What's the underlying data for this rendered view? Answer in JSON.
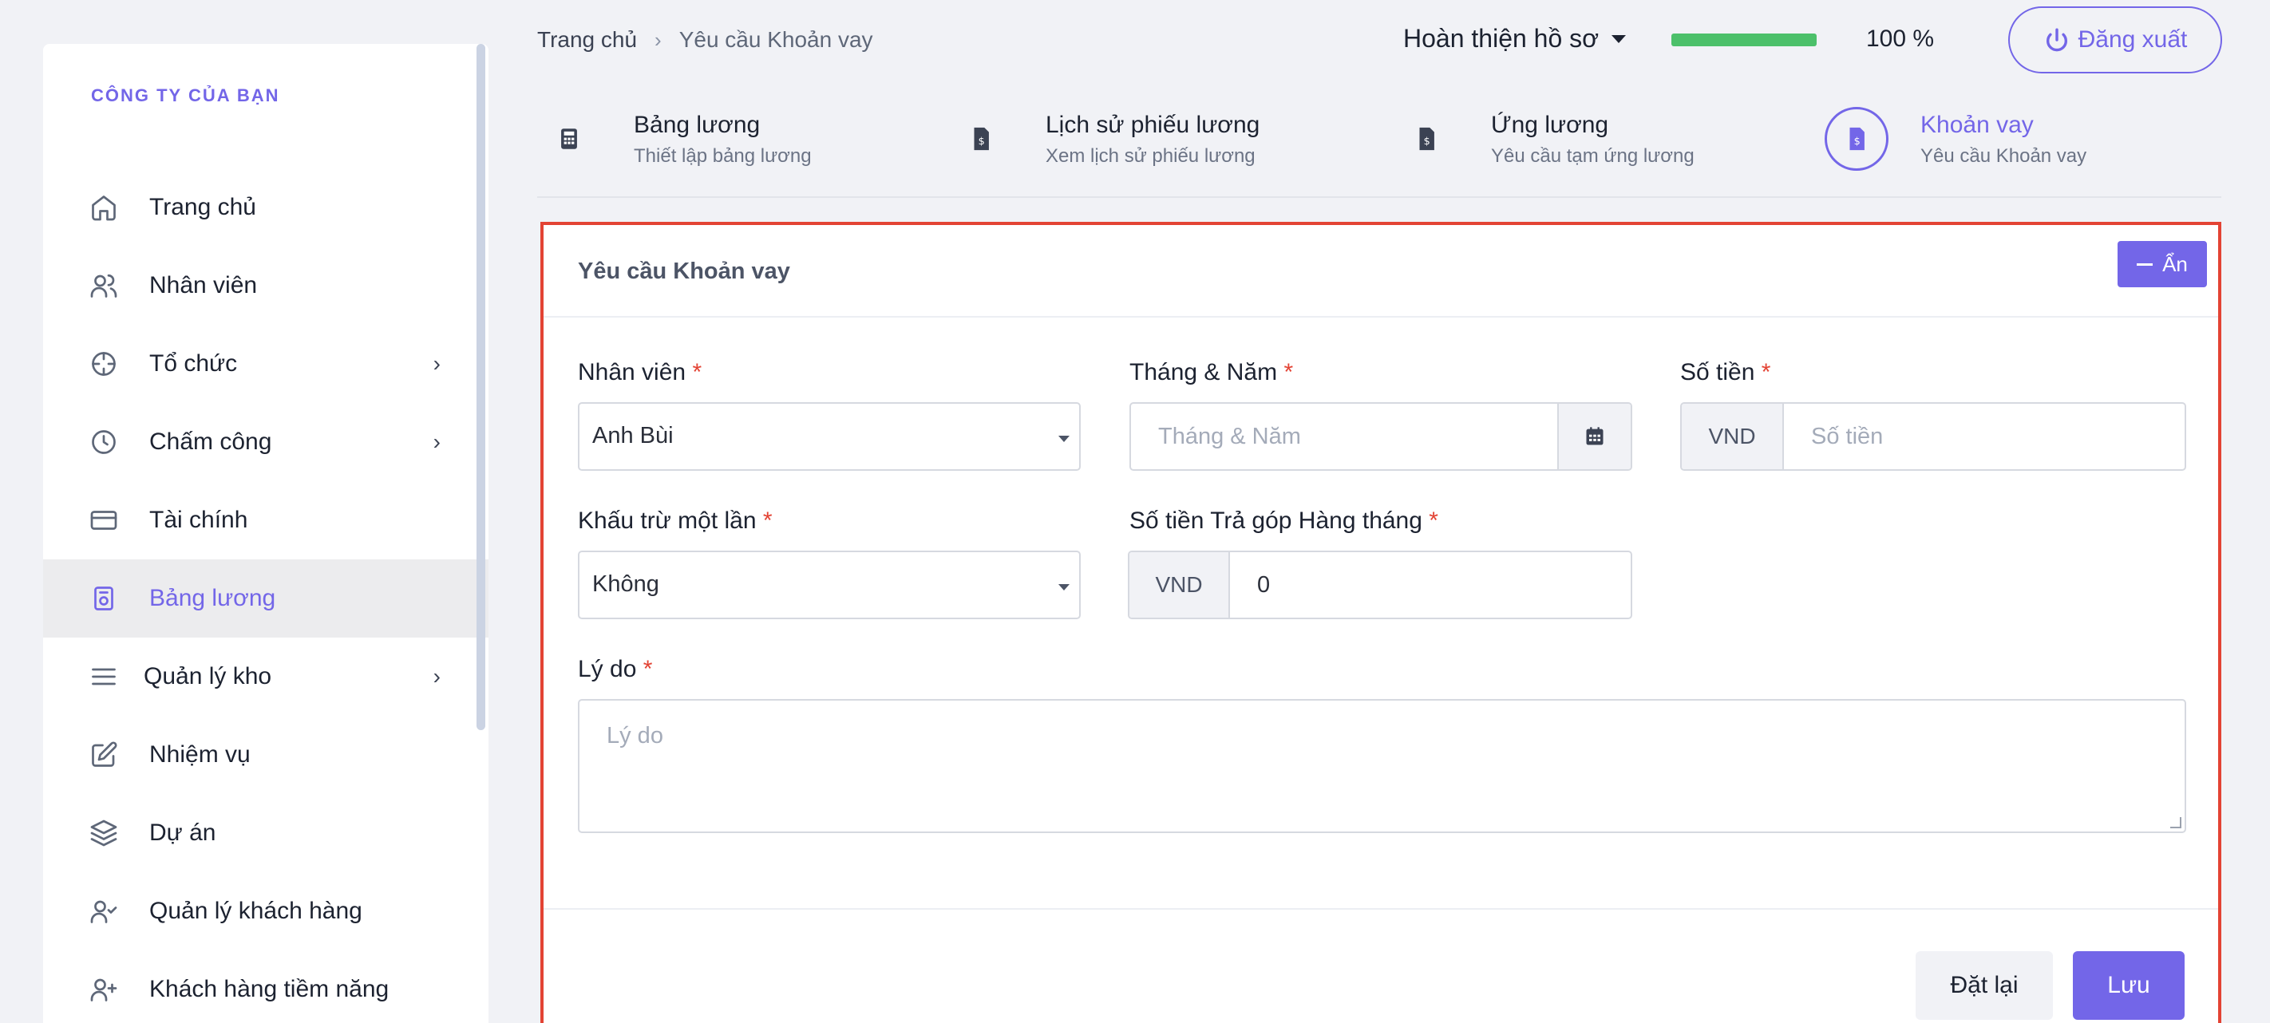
{
  "colors": {
    "accent": "#7366e8",
    "danger": "#e34334",
    "progress": "#4cc06a"
  },
  "sidebar": {
    "brand": "CÔNG TY CỦA BẠN",
    "items": [
      {
        "label": "Trang chủ",
        "icon": "home-icon",
        "chevron": ""
      },
      {
        "label": "Nhân viên",
        "icon": "users-icon",
        "chevron": ""
      },
      {
        "label": "Tổ chức",
        "icon": "crosshair-icon",
        "chevron": "›"
      },
      {
        "label": "Chấm công",
        "icon": "clock-icon",
        "chevron": "›"
      },
      {
        "label": "Tài chính",
        "icon": "credit-card-icon",
        "chevron": ""
      },
      {
        "label": "Bảng lương",
        "icon": "payroll-icon",
        "chevron": "",
        "active": true
      },
      {
        "label": "Quản lý kho",
        "icon": "menu-icon",
        "chevron": "›"
      },
      {
        "label": "Nhiệm vụ",
        "icon": "edit-icon",
        "chevron": ""
      },
      {
        "label": "Dự án",
        "icon": "layers-icon",
        "chevron": ""
      },
      {
        "label": "Quản lý khách hàng",
        "icon": "user-check-icon",
        "chevron": ""
      },
      {
        "label": "Khách hàng tiềm năng",
        "icon": "user-plus-icon",
        "chevron": ""
      }
    ]
  },
  "header": {
    "breadcrumb": {
      "home": "Trang chủ",
      "separator": "›",
      "current": "Yêu cầu Khoản vay"
    },
    "complete_profile": "Hoàn thiện hồ sơ",
    "progress_percent": 100,
    "progress_text": "100 %",
    "logout": "Đăng xuất"
  },
  "tabs": [
    {
      "title": "Bảng lương",
      "subtitle": "Thiết lập bảng lương",
      "icon": "calculator-icon"
    },
    {
      "title": "Lịch sử phiếu lương",
      "subtitle": "Xem lịch sử phiếu lương",
      "icon": "invoice-dollar-icon"
    },
    {
      "title": "Ứng lương",
      "subtitle": "Yêu cầu tạm ứng lương",
      "icon": "invoice-dollar-icon"
    },
    {
      "title": "Khoản vay",
      "subtitle": "Yêu cầu Khoản vay",
      "icon": "invoice-dollar-icon",
      "active": true
    }
  ],
  "form": {
    "title": "Yêu cầu Khoản vay",
    "hide_label": "Ẩn",
    "required_mark": "*",
    "employee": {
      "label": "Nhân viên",
      "value": "Anh Bùi"
    },
    "month_year": {
      "label": "Tháng & Năm",
      "placeholder": "Tháng & Năm"
    },
    "amount": {
      "label": "Số tiền",
      "currency": "VND",
      "placeholder": "Số tiền"
    },
    "one_time": {
      "label": "Khấu trừ một lần",
      "value": "Không"
    },
    "monthly": {
      "label": "Số tiền Trả góp Hàng tháng",
      "currency": "VND",
      "value": "0"
    },
    "reason": {
      "label": "Lý do",
      "placeholder": "Lý do"
    },
    "reset": "Đặt lại",
    "save": "Lưu"
  }
}
